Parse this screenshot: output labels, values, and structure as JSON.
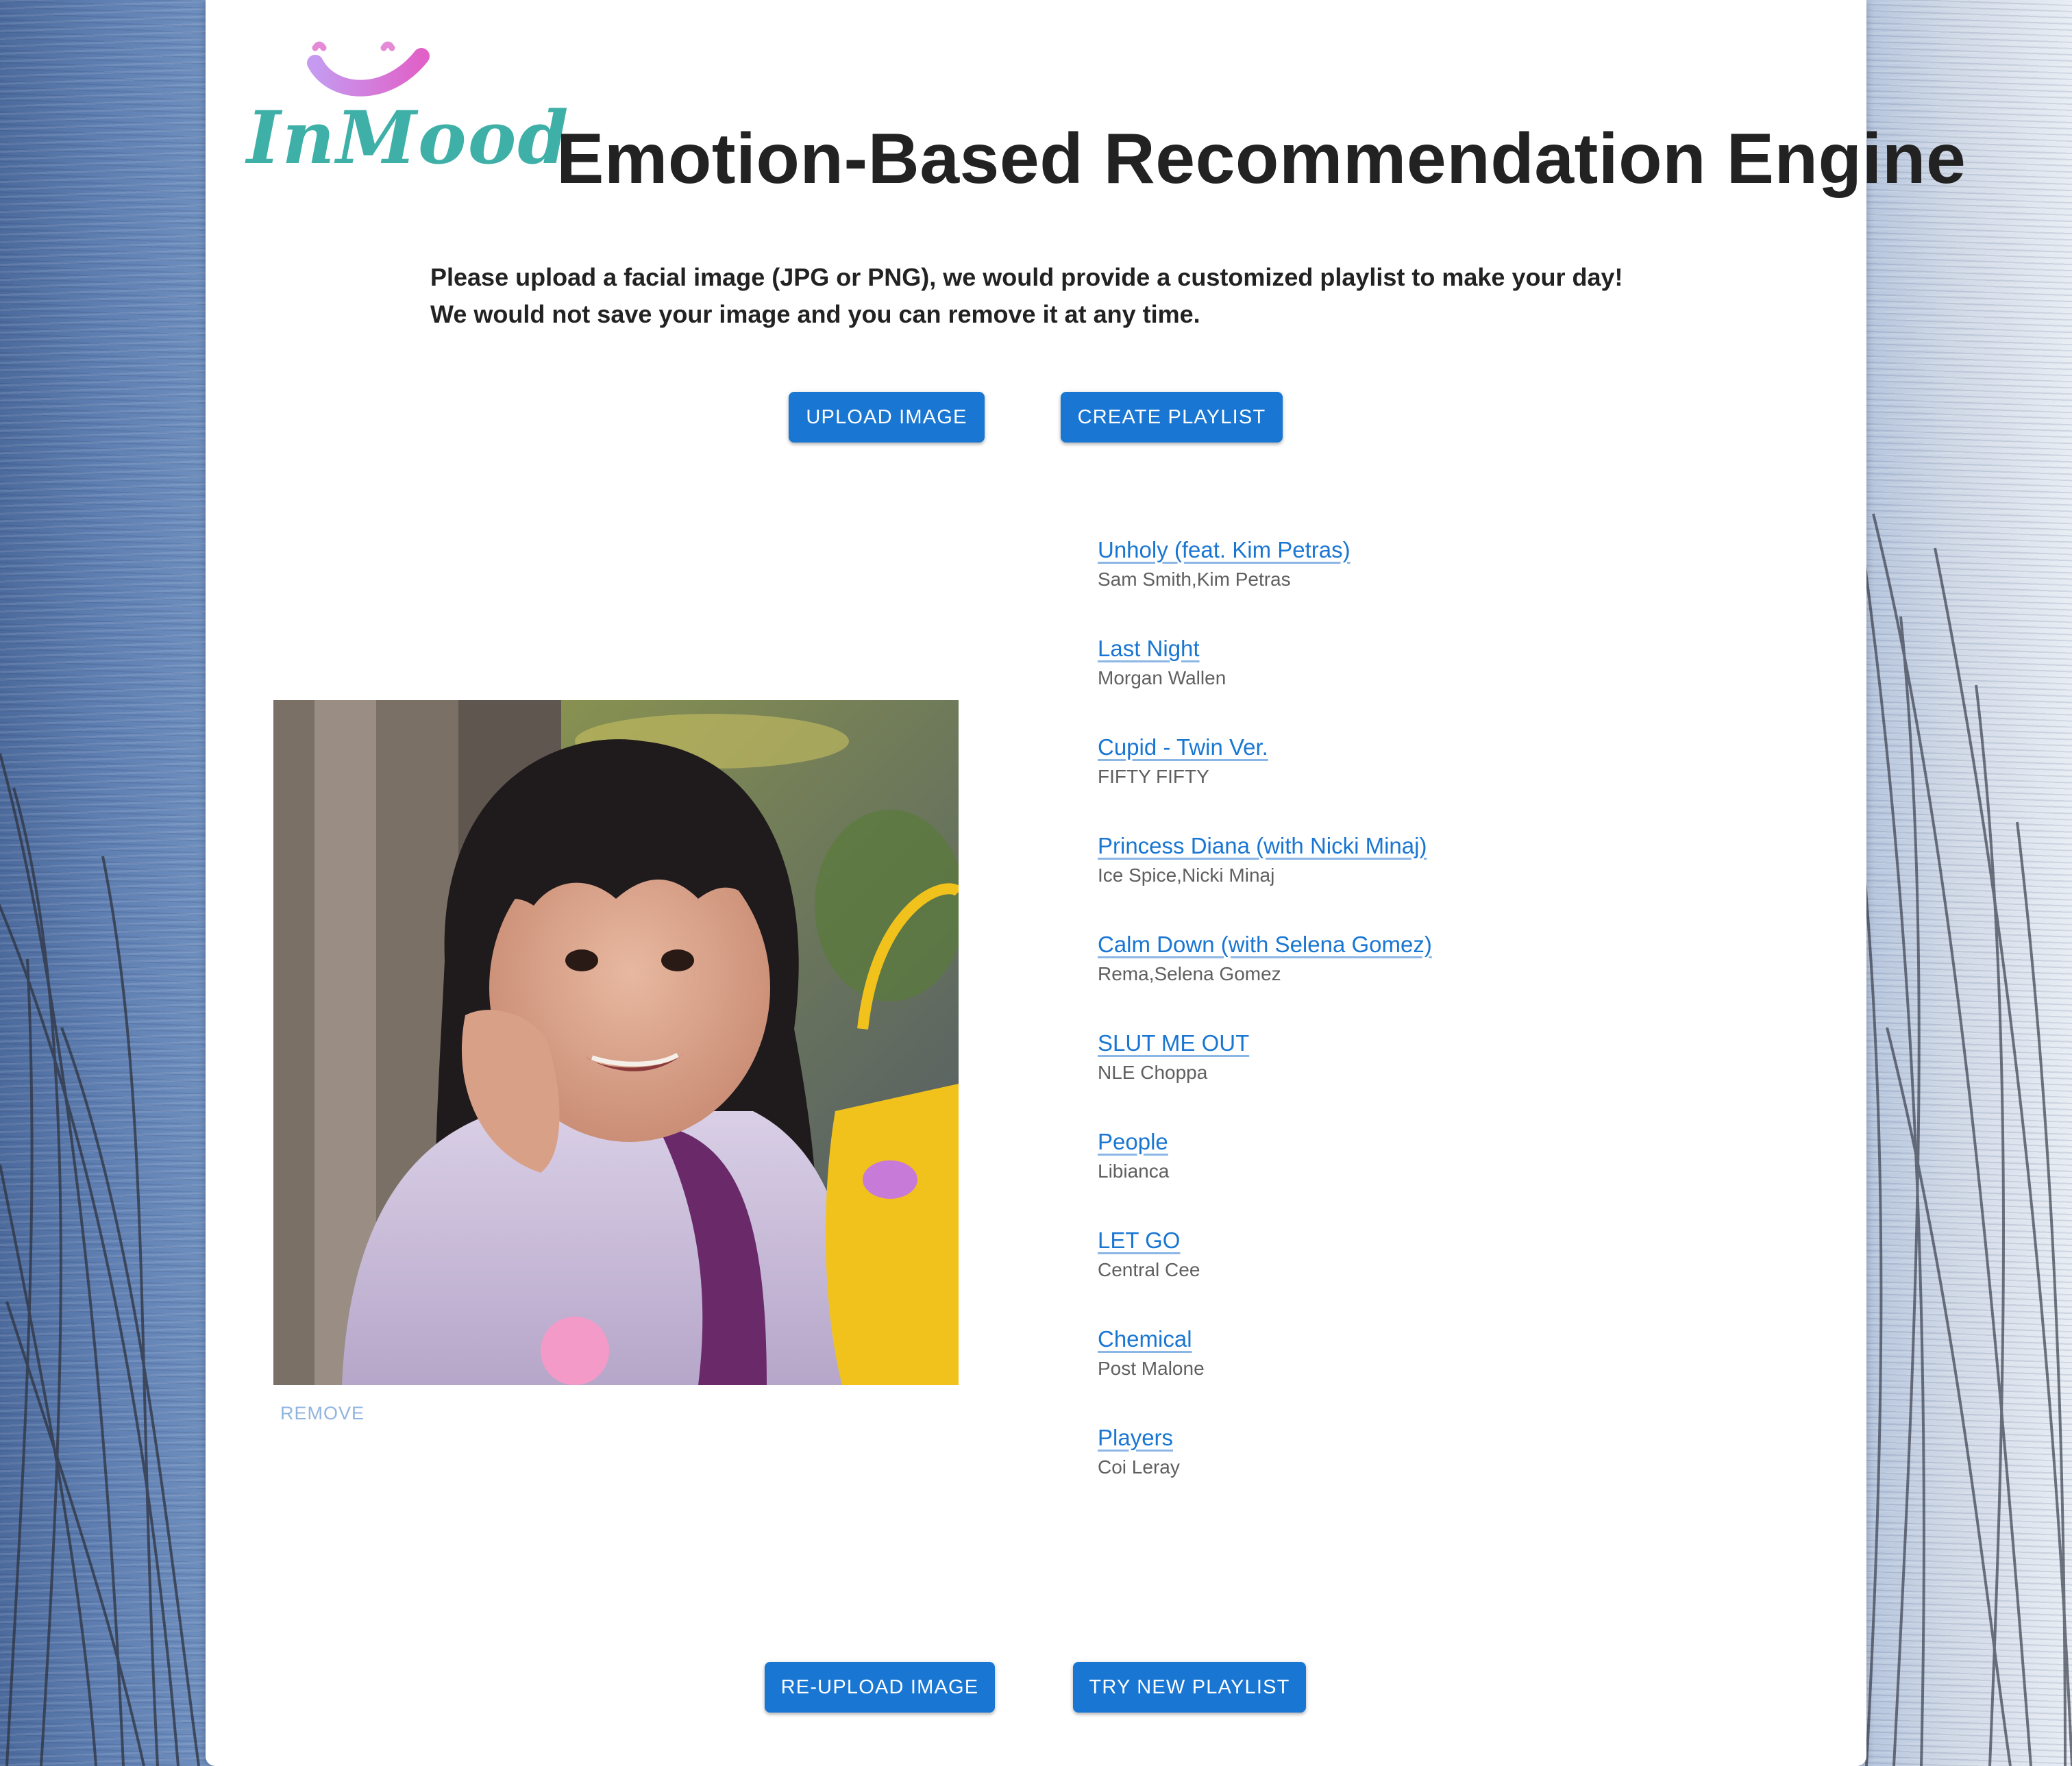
{
  "header": {
    "logo_text": "InMood",
    "title": "Emotion-Based Recommendation Engine"
  },
  "intro": {
    "line1": "Please upload a facial image (JPG or PNG), we would provide a customized playlist to make your day!",
    "line2": "We would not save your image and you can remove it at any time."
  },
  "actions": {
    "upload_label": "UPLOAD IMAGE",
    "create_label": "CREATE PLAYLIST",
    "reupload_label": "RE-UPLOAD IMAGE",
    "try_new_label": "TRY NEW PLAYLIST"
  },
  "image": {
    "remove_label": "REMOVE"
  },
  "playlist": [
    {
      "title": "Unholy (feat. Kim Petras)",
      "artist": "Sam Smith,Kim Petras"
    },
    {
      "title": "Last Night",
      "artist": "Morgan Wallen"
    },
    {
      "title": "Cupid - Twin Ver.",
      "artist": "FIFTY FIFTY"
    },
    {
      "title": "Princess Diana (with Nicki Minaj)",
      "artist": "Ice Spice,Nicki Minaj"
    },
    {
      "title": "Calm Down (with Selena Gomez)",
      "artist": "Rema,Selena Gomez"
    },
    {
      "title": "SLUT ME OUT",
      "artist": "NLE Choppa"
    },
    {
      "title": "People",
      "artist": "Libianca"
    },
    {
      "title": "LET GO",
      "artist": "Central Cee"
    },
    {
      "title": "Chemical",
      "artist": "Post Malone"
    },
    {
      "title": "Players",
      "artist": "Coi Leray"
    }
  ],
  "colors": {
    "primary": "#1976d2",
    "logo_teal": "#3fb0a8",
    "logo_pink": "#d66fd6",
    "title_text": "#222222",
    "artist_text": "#5f5f5f",
    "remove_text": "#90b4e0"
  },
  "icons": {
    "logo_mark": "smile-icon"
  }
}
